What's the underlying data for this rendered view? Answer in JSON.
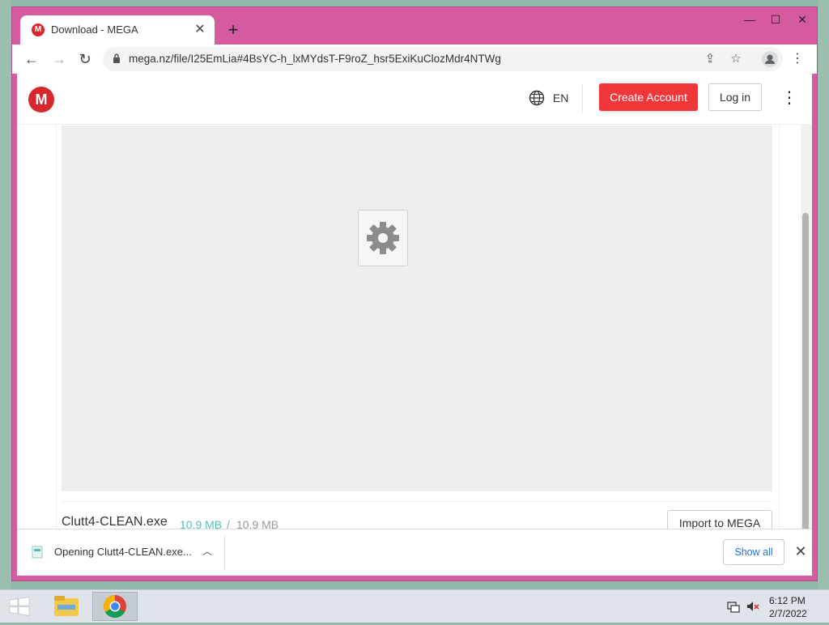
{
  "browser": {
    "tab_title": "Download - MEGA",
    "tab_favicon": "M",
    "url": "mega.nz/file/I25EmLia#4BsYC-h_lxMYdsT-F9roZ_hsr5ExiKuClozMdr4NTWg"
  },
  "header": {
    "logo": "M",
    "language": "EN",
    "create_account": "Create Account",
    "login": "Log in"
  },
  "file": {
    "name": "Clutt4-CLEAN.exe",
    "downloaded": "10.9 MB",
    "separator": "/",
    "total": "10.9 MB",
    "import_label": "Import to MEGA"
  },
  "download_shelf": {
    "item_text": "Opening Clutt4-CLEAN.exe...",
    "show_all": "Show all"
  },
  "taskbar": {
    "time": "6:12 PM",
    "date": "2/7/2022"
  },
  "colors": {
    "window_frame": "#d65aa0",
    "mega_red": "#d9272e",
    "create_button": "#f0373a",
    "progress_teal": "#4fc2b5",
    "link_blue": "#1a73e8"
  },
  "icons": [
    "globe-icon",
    "gear-icon",
    "share-icon",
    "star-icon",
    "profile-icon",
    "lock-icon",
    "chevron-up-icon",
    "close-icon",
    "windows-start-icon",
    "file-explorer-icon",
    "chrome-icon",
    "network-icon",
    "volume-muted-icon"
  ]
}
